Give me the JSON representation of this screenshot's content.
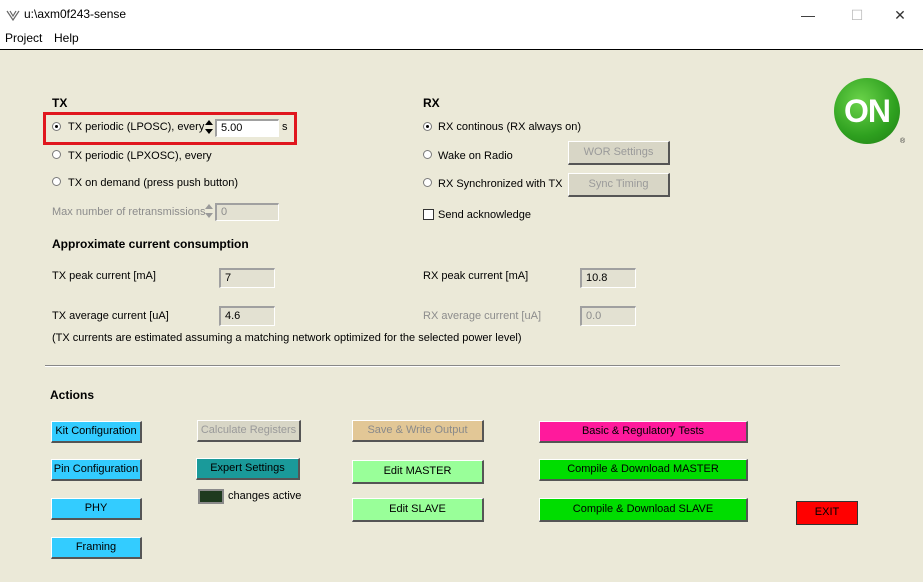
{
  "window": {
    "title": "u:\\axm0f243-sense",
    "minimize": "—",
    "maximize": "☐",
    "close": "✕"
  },
  "menu": {
    "items": [
      "Project",
      "Help"
    ]
  },
  "logo": {
    "text": "ON",
    "registered": "®"
  },
  "tx": {
    "heading": "TX",
    "periodic_lposc_label": "TX periodic (LPOSC), every",
    "periodic_lposc_value": "5.00",
    "periodic_unit": "s",
    "periodic_lpxosc_label": "TX periodic (LPXOSC), every",
    "on_demand_label": "TX on demand (press push button)",
    "max_retrans_label": "Max number of retransmissions",
    "max_retrans_value": "0",
    "selected": "TX periodic (LPOSC), every"
  },
  "rx": {
    "heading": "RX",
    "continuous_label": "RX continous (RX always on)",
    "wake_label": "Wake on Radio",
    "wor_button": "WOR Settings",
    "sync_label": "RX Synchronized with TX",
    "sync_button": "Sync Timing",
    "ack_label": "Send acknowledge",
    "selected": "RX continous (RX always on)"
  },
  "current": {
    "heading": "Approximate current consumption",
    "tx_peak_label": "TX peak current [mA]",
    "tx_peak_value": "7",
    "tx_avg_label": "TX average current [uA]",
    "tx_avg_value": "4.6",
    "rx_peak_label": "RX peak current [mA]",
    "rx_peak_value": "10.8",
    "rx_avg_label": "RX average current [uA]",
    "rx_avg_value": "0.0",
    "note": "(TX currents are estimated assuming a matching network optimized for the selected power level)"
  },
  "actions": {
    "heading": "Actions",
    "kit_config": "Kit Configuration",
    "pin_config": "Pin Configuration",
    "phy": "PHY",
    "framing": "Framing",
    "calc_registers": "Calculate Registers",
    "expert_settings": "Expert Settings",
    "changes_active": "changes active",
    "save_write": "Save & Write Output",
    "edit_master": "Edit MASTER",
    "edit_slave": "Edit SLAVE",
    "basic_tests": "Basic & Regulatory Tests",
    "compile_master": "Compile & Download MASTER",
    "compile_slave": "Compile & Download SLAVE",
    "exit": "EXIT"
  },
  "colors": {
    "cyan_button": "#33ccff",
    "teal_button": "#1a9a9a",
    "tan_button": "#e2c796",
    "light_green_button": "#99ff99",
    "magenta_button": "#ff1a9c",
    "green_button": "#00dd00",
    "red_button": "#ff0000",
    "highlight": "#e0161e"
  }
}
